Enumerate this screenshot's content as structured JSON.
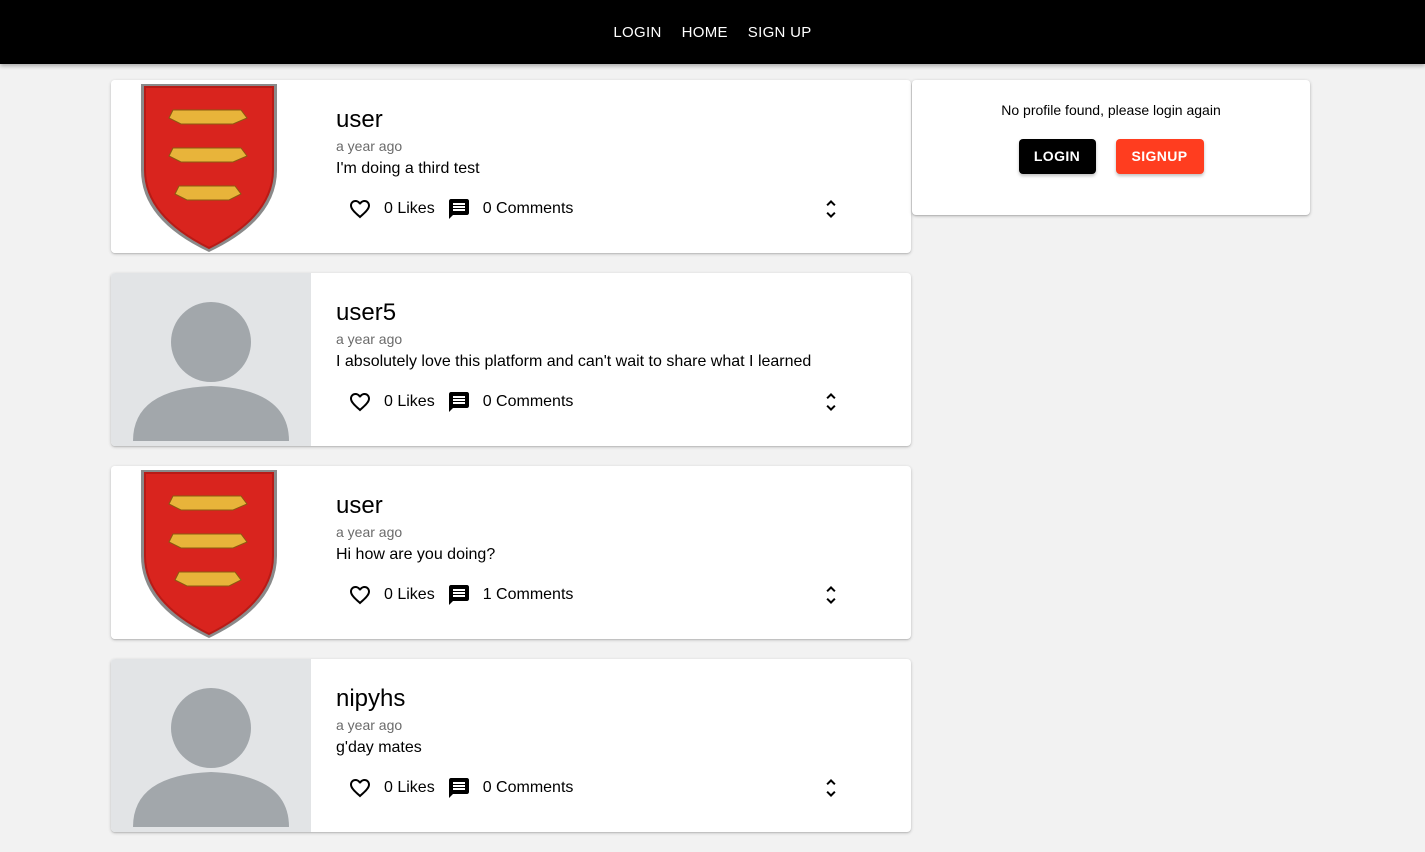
{
  "nav": {
    "links": [
      "LOGIN",
      "HOME",
      "SIGN UP"
    ]
  },
  "sidebar": {
    "message": "No profile found, please login again",
    "login_label": "LOGIN",
    "signup_label": "SIGNUP",
    "colors": {
      "login": "#000000",
      "signup": "#ff3d1f"
    }
  },
  "posts": [
    {
      "username": "user",
      "time": "a year ago",
      "body": "I'm doing a third test",
      "likes": "0 Likes",
      "comments": "0 Comments",
      "avatar": "crest-image"
    },
    {
      "username": "user5",
      "time": "a year ago",
      "body": "I absolutely love this platform and can't wait to share what I learned",
      "likes": "0 Likes",
      "comments": "0 Comments",
      "avatar": "default-avatar-icon"
    },
    {
      "username": "user",
      "time": "a year ago",
      "body": "Hi how are you doing?",
      "likes": "0 Likes",
      "comments": "1 Comments",
      "avatar": "crest-image"
    },
    {
      "username": "nipyhs",
      "time": "a year ago",
      "body": "g'day mates",
      "likes": "0 Likes",
      "comments": "0 Comments",
      "avatar": "default-avatar-icon"
    }
  ]
}
